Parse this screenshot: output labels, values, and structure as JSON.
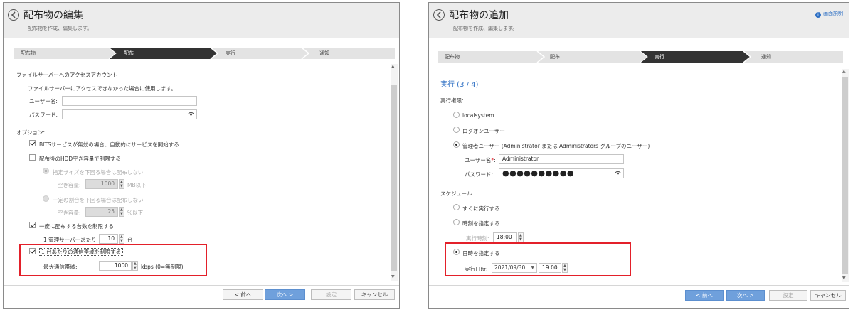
{
  "left": {
    "title": "配布物の編集",
    "subtitle": "配布物を作成、編集します。",
    "steps": [
      "配布物",
      "配布",
      "実行",
      "通知"
    ],
    "active_step": 1,
    "account_section": "ファイルサーバーへのアクセスアカウント",
    "account_note": "ファイルサーバーにアクセスできなかった場合に使用します。",
    "username_label": "ユーザー名:",
    "password_label": "パスワード:",
    "options_label": "オプション:",
    "bits_option": "BITSサービスが無効の場合、自動的にサービスを開始する",
    "hdd_option": "配布後のHDD空き容量で制限する",
    "size_radio": "指定サイズを下回る場合は配布しない",
    "free_space_label": "空き容量:",
    "free_space_value": "1000",
    "free_space_unit": "MB以下",
    "ratio_radio": "一定の割合を下回る場合は配布しない",
    "free_ratio_label": "空き容量:",
    "free_ratio_value": "25",
    "free_ratio_unit": "%以下",
    "limit_count_option": "一度に配布する台数を制限する",
    "per_server_label": "1 管理サーバーあたり",
    "per_server_value": "10",
    "per_server_unit": "台",
    "bandwidth_option": "1 台あたりの通信帯域を制限する",
    "max_bandwidth_label": "最大通信帯域:",
    "max_bandwidth_value": "1000",
    "max_bandwidth_unit": "kbps (0=無制限)",
    "buttons": {
      "prev": "< 前へ",
      "next": "次へ >",
      "settings": "設定",
      "cancel": "キャンセル"
    }
  },
  "right": {
    "title": "配布物の追加",
    "subtitle": "配布物を作成、編集します。",
    "help": "画面説明",
    "steps": [
      "配布物",
      "配布",
      "実行",
      "通知"
    ],
    "active_step": 2,
    "section_title": "実行 (3 / 4)",
    "permission_label": "実行権限:",
    "opt_localsystem": "localsystem",
    "opt_logon_user": "ログオンユーザー",
    "opt_admin_user": "管理者ユーザー (Administrator または Administrators グループのユーザー)",
    "username_label": "ユーザー名",
    "username_value": "Administrator",
    "password_label": "パスワード:",
    "password_value": "●●●●●●●●●●",
    "schedule_label": "スケジュール:",
    "opt_now": "すぐに実行する",
    "opt_time": "時刻を指定する",
    "exec_time_label": "実行時刻:",
    "exec_time_value": "18:00",
    "opt_datetime": "日時を指定する",
    "exec_datetime_label": "実行日時:",
    "exec_date_value": "2021/09/30",
    "exec_datetime_time": "19:00",
    "buttons": {
      "prev": "< 前へ",
      "next": "次へ >",
      "settings": "設定",
      "cancel": "キャンセル"
    }
  },
  "colors": {
    "accent": "#6fa0dc",
    "highlight": "#e3202a",
    "active_step": "#333333",
    "link": "#2d6fc4"
  }
}
